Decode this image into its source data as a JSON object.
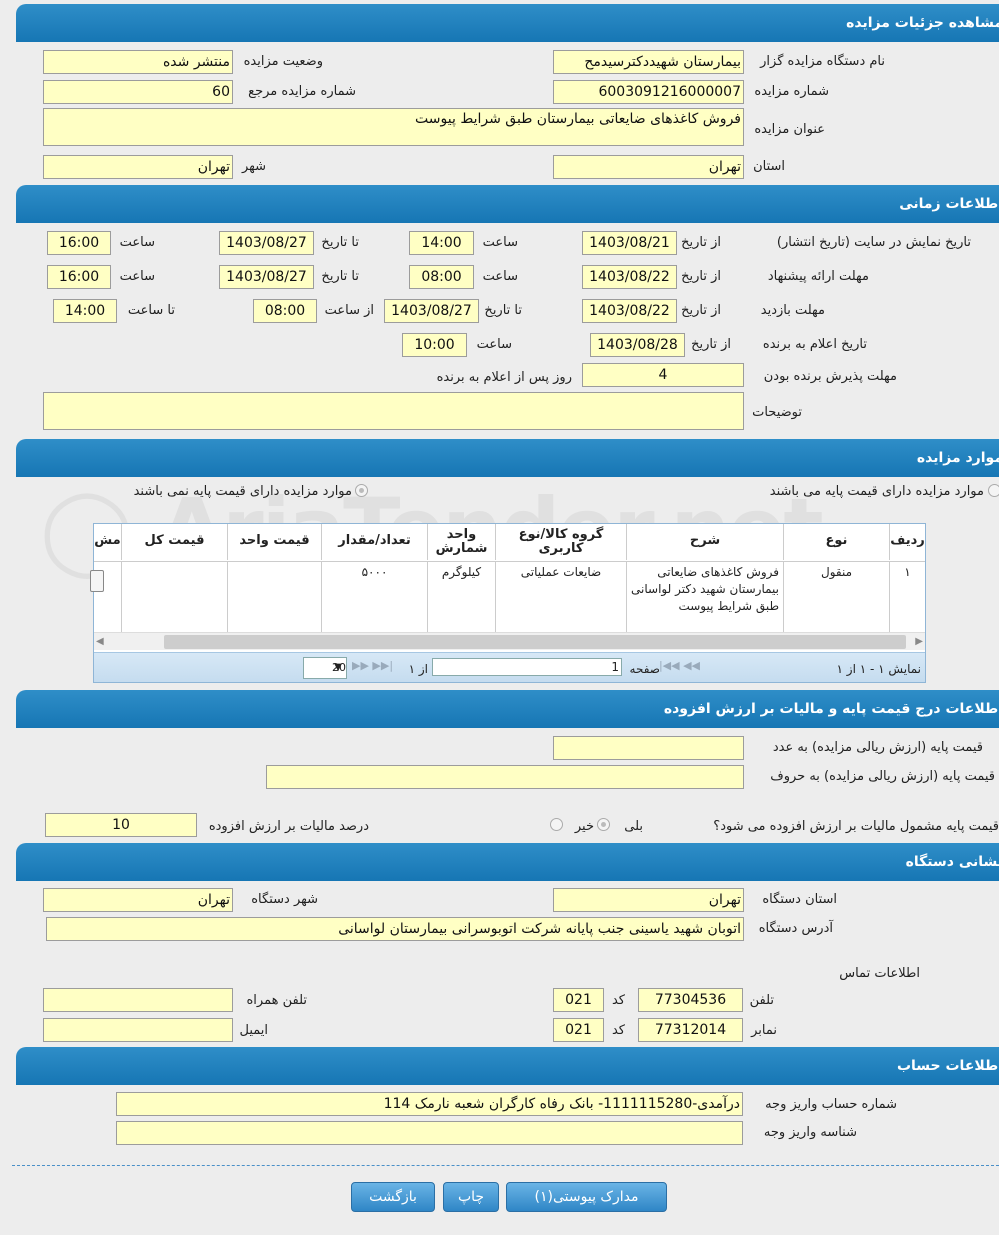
{
  "sections": {
    "details": "مشاهده جزئیات مزایده",
    "time": "اطلاعات زمانی",
    "items": "موارد مزایده",
    "base_price": "اطلاعات درج قیمت پایه و مالیات بر ارزش افزوده",
    "address": "نشانی دستگاه",
    "account": "اطلاعات حساب"
  },
  "details": {
    "org_label": "نام دستگاه مزایده گزار",
    "org_value": "بیمارستان شهیددکترسیدمح",
    "status_label": "وضعیت مزایده",
    "status_value": "منتشر شده",
    "number_label": "شماره مزایده",
    "number_value": "6003091216000007",
    "ref_label": "شماره مزایده مرجع",
    "ref_value": "60",
    "title_label": "عنوان مزایده",
    "title_value": "فروش کاغذهای ضایعاتی بیمارستان طبق شرایط پیوست",
    "province_label": "استان",
    "province_value": "تهران",
    "city_label": "شهر",
    "city_value": "تهران"
  },
  "time": {
    "display_label": "تاریخ نمایش در سایت (تاریخ انتشار)",
    "offer_label": "مهلت ارائه پیشنهاد",
    "visit_label": "مهلت بازدید",
    "announce_label": "تاریخ اعلام به برنده",
    "accept_label": "مهلت پذیرش برنده بودن",
    "desc_label": "توضیحات",
    "from_date": "از تاریخ",
    "to_date": "تا تاریخ",
    "hour": "ساعت",
    "from_hour": "از ساعت",
    "to_hour": "تا ساعت",
    "days_after": "روز پس از اعلام به برنده",
    "display_from": "1403/08/21",
    "display_from_time": "14:00",
    "display_to": "1403/08/27",
    "display_to_time": "16:00",
    "offer_from": "1403/08/22",
    "offer_from_time": "08:00",
    "offer_to": "1403/08/27",
    "offer_to_time": "16:00",
    "visit_from": "1403/08/22",
    "visit_to": "1403/08/27",
    "visit_from_time": "08:00",
    "visit_to_time": "14:00",
    "announce_date": "1403/08/28",
    "announce_time": "10:00",
    "accept_days": "4",
    "desc_value": ""
  },
  "items": {
    "radio_with": "موارد مزایده دارای قیمت پایه می باشند",
    "radio_without": "موارد مزایده دارای قیمت پایه نمی باشند",
    "headers": {
      "row": "ردیف",
      "type": "نوع",
      "desc": "شرح",
      "group": "گروه کالا/نوع کاربری",
      "unit": "واحد شمارش",
      "qty": "تعداد/مقدار",
      "unit_price": "قیمت واحد",
      "total": "قیمت کل",
      "more": "مش"
    },
    "row": {
      "row": "۱",
      "type": "منقول",
      "desc": "فروش کاغذهای ضایعاتی بیمارستان شهید دکتر لواسانی طبق شرایط پیوست",
      "group": "ضایعات عملیاتی",
      "unit": "کیلوگرم",
      "qty": "۵۰۰۰",
      "unit_price": "",
      "total": ""
    },
    "pager": {
      "showing": "نمایش ۱ - ۱ از ۱",
      "page_label": "صفحه",
      "page_value": "1",
      "of_label": "از ۱",
      "page_size": "20"
    }
  },
  "base_price": {
    "num_label": "قیمت پایه (ارزش ریالی مزایده) به عدد",
    "num_value": "",
    "text_label": "قیمت پایه (ارزش ریالی مزایده) به حروف",
    "text_value": "",
    "vat_question": "قیمت پایه مشمول مالیات بر ارزش افزوده می شود؟",
    "yes": "بلی",
    "no": "خیر",
    "vat_label": "درصد مالیات بر ارزش افزوده",
    "vat_value": "10"
  },
  "address": {
    "province_label": "استان دستگاه",
    "province_value": "تهران",
    "city_label": "شهر دستگاه",
    "city_value": "تهران",
    "addr_label": "آدرس دستگاه",
    "addr_value": "اتوبان شهید یاسینی جنب پایانه شرکت اتوبوسرانی بیمارستان لواسانی",
    "contact_label": "اطلاعات تماس",
    "phone_label": "تلفن",
    "phone_value": "77304536",
    "code_label": "کد",
    "phone_code": "021",
    "mobile_label": "تلفن همراه",
    "mobile_value": "",
    "fax_label": "نمابر",
    "fax_value": "77312014",
    "fax_code": "021",
    "email_label": "ایمیل",
    "email_value": ""
  },
  "account": {
    "acc_label": "شماره حساب واریز وجه",
    "acc_value": "درآمدی-1111115280- بانک رفاه کارگران شعبه نارمک 114",
    "id_label": "شناسه واریز وجه",
    "id_value": ""
  },
  "buttons": {
    "attachments": "مدارک پیوستی(۱)",
    "print": "چاپ",
    "back": "بازگشت"
  },
  "watermark": "AriaTender.net"
}
